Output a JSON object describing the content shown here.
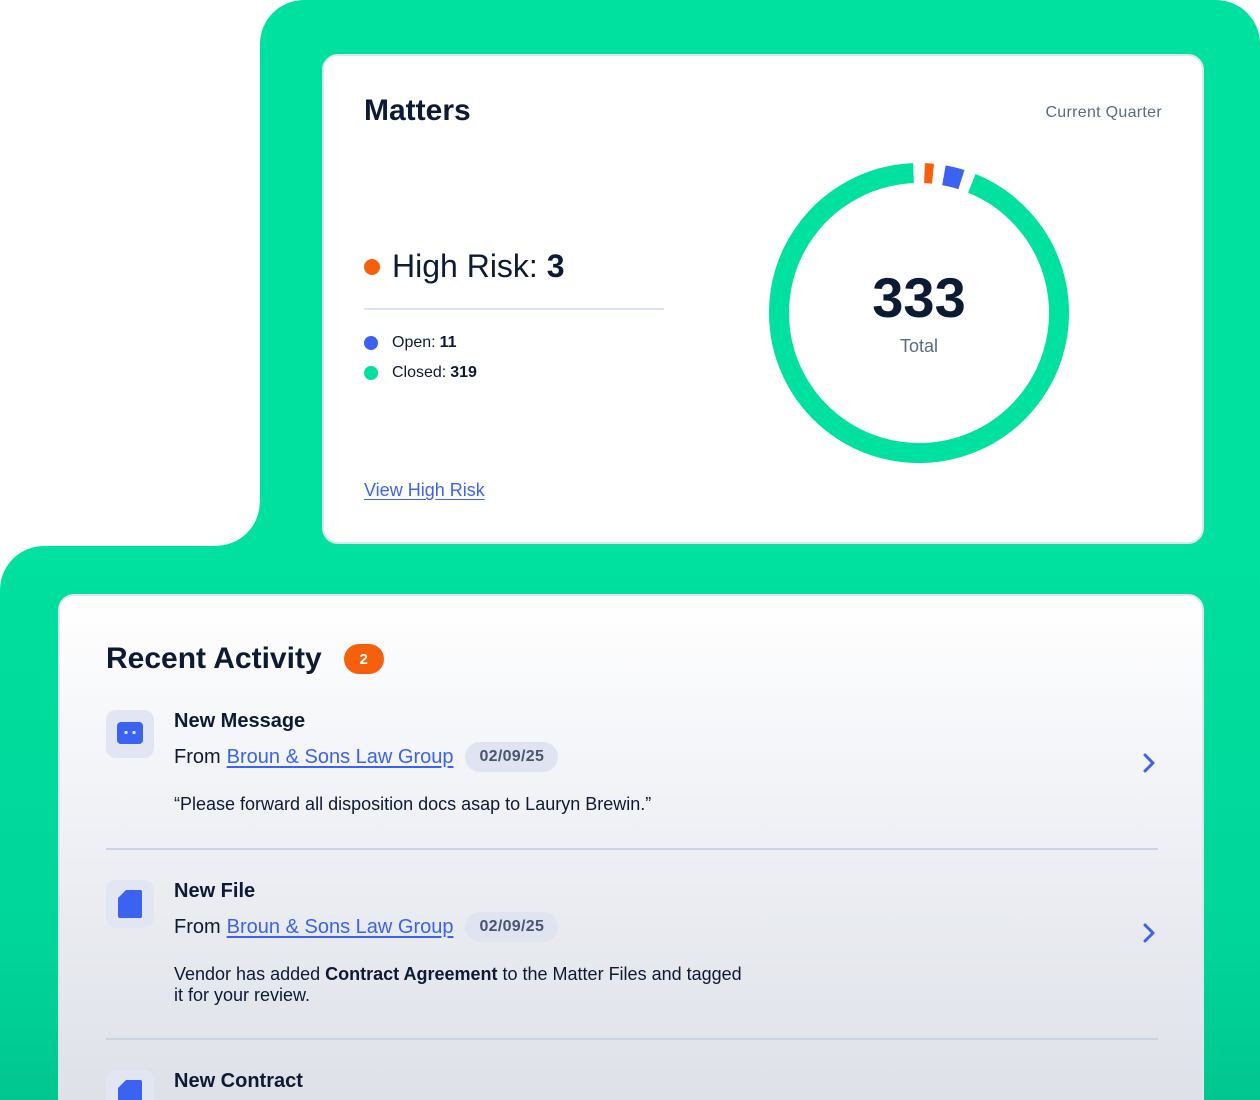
{
  "colors": {
    "brand_green": "#00e09e",
    "high_risk": "#f6600c",
    "open": "#3b62f0",
    "closed": "#00e09e",
    "link": "#3b62f0"
  },
  "matters": {
    "title": "Matters",
    "period": "Current Quarter",
    "high_risk_label": "High Risk:",
    "high_risk_value": "3",
    "open_label": "Open:",
    "open_value": "11",
    "closed_label": "Closed:",
    "closed_value": "319",
    "total_value": "333",
    "total_label": "Total",
    "view_link": "View High Risk"
  },
  "chart_data": {
    "type": "pie",
    "donut": true,
    "categories": [
      "High Risk",
      "Open",
      "Closed"
    ],
    "values": [
      3,
      11,
      319
    ],
    "colors": [
      "#f6600c",
      "#3b62f0",
      "#00e09e"
    ],
    "center_value": "333",
    "center_label": "Total"
  },
  "activity": {
    "title": "Recent Activity",
    "badge_count": "2",
    "items": [
      {
        "title": "New Message",
        "icon": "chat-bubble-icon",
        "from_label": "From",
        "from_link": "Broun & Sons Law Group",
        "date": "02/09/25",
        "body": "“Please forward all disposition docs asap to Lauryn Brewin.”"
      },
      {
        "title": "New File",
        "icon": "document-icon",
        "from_label": "From",
        "from_link": "Broun & Sons Law Group",
        "date": "02/09/25",
        "body_pre": "Vendor has added ",
        "body_bold": "Contract Agreement",
        "body_post": " to the Matter Files and tagged it for your review."
      },
      {
        "title": "New Contract",
        "icon": "document-icon"
      }
    ]
  }
}
